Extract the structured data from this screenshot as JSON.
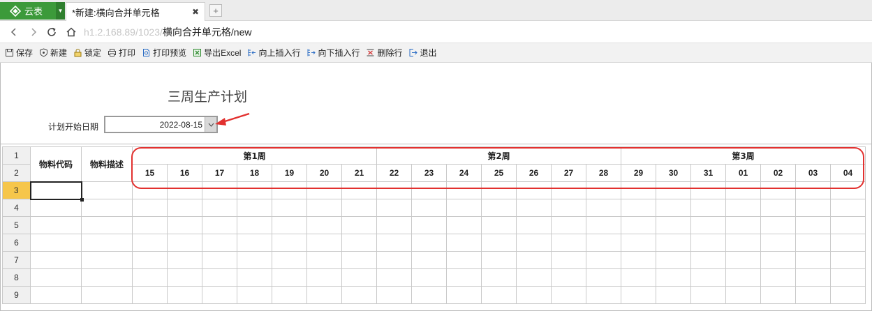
{
  "app": {
    "name": "云表"
  },
  "tab": {
    "title": "*新建:横向合并单元格",
    "close": "✖",
    "new_tab": "+"
  },
  "address": {
    "blurred": "h1.2.168.89/1023/",
    "path": "横向合并单元格/new"
  },
  "toolbar": {
    "items": [
      {
        "label": "保存",
        "icon": "save-icon"
      },
      {
        "label": "新建",
        "icon": "new-icon"
      },
      {
        "label": "锁定",
        "icon": "lock-icon"
      },
      {
        "label": "打印",
        "icon": "print-icon"
      },
      {
        "label": "打印预览",
        "icon": "print-preview-icon"
      },
      {
        "label": "导出Excel",
        "icon": "excel-icon"
      },
      {
        "label": "向上插入行",
        "icon": "insert-above-icon"
      },
      {
        "label": "向下插入行",
        "icon": "insert-below-icon"
      },
      {
        "label": "删除行",
        "icon": "delete-row-icon"
      },
      {
        "label": "退出",
        "icon": "exit-icon"
      }
    ]
  },
  "form": {
    "title": "三周生产计划",
    "date_label": "计划开始日期",
    "date_value": "2022-08-15"
  },
  "grid": {
    "col_code": "物料代码",
    "col_desc": "物料描述",
    "weeks": [
      "第1周",
      "第2周",
      "第3周"
    ],
    "days": [
      "15",
      "16",
      "17",
      "18",
      "19",
      "20",
      "21",
      "22",
      "23",
      "24",
      "25",
      "26",
      "27",
      "28",
      "29",
      "30",
      "31",
      "01",
      "02",
      "03",
      "04"
    ],
    "row_numbers": [
      "1",
      "2",
      "3",
      "4",
      "5",
      "6",
      "7",
      "8",
      "9"
    ]
  },
  "colors": {
    "accent_green": "#3c9a3a",
    "highlight_red": "#e2312f",
    "selected_row": "#f6c64b"
  }
}
